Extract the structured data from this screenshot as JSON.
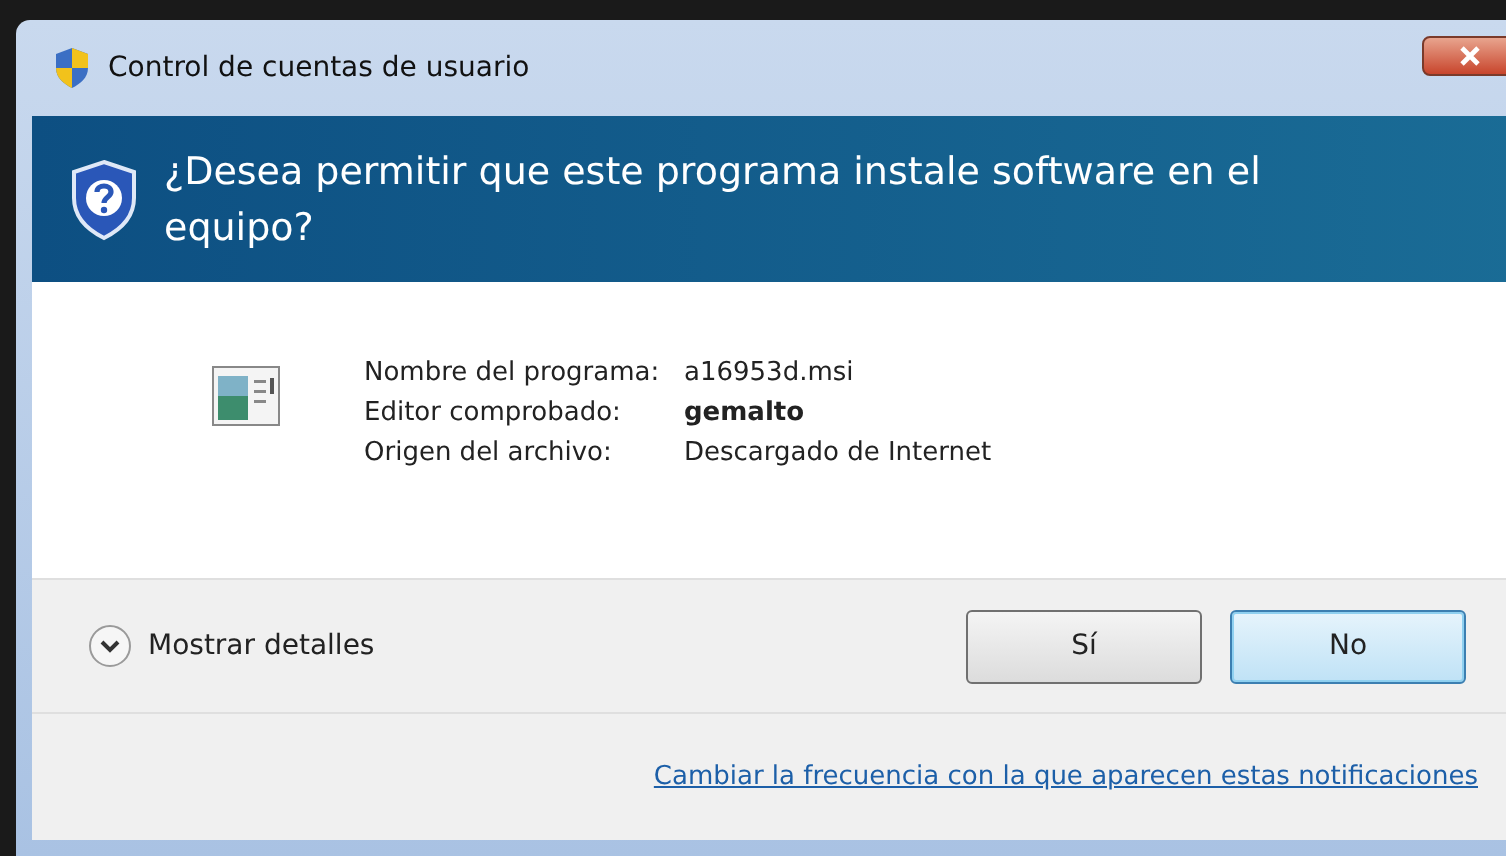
{
  "window": {
    "title": "Control de cuentas de usuario"
  },
  "header": {
    "question": "¿Desea permitir que este programa instale software en el equipo?"
  },
  "details": [
    {
      "label": "Nombre del programa:",
      "value": "a16953d.msi",
      "bold": false
    },
    {
      "label": "Editor comprobado:",
      "value": "gemalto",
      "bold": true
    },
    {
      "label": "Origen del archivo:",
      "value": "Descargado de Internet",
      "bold": false
    }
  ],
  "expander": {
    "label": "Mostrar detalles",
    "expanded": false
  },
  "buttons": [
    {
      "label": "Sí",
      "default": false
    },
    {
      "label": "No",
      "default": true
    }
  ],
  "footer_link": "Cambiar la frecuencia con la que aparecen estas notificaciones"
}
